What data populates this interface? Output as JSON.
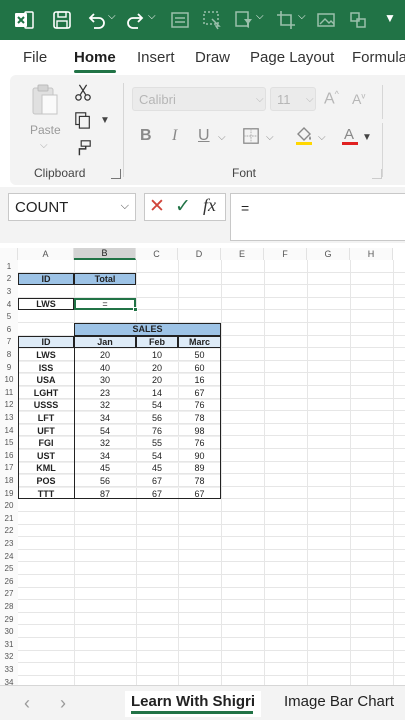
{
  "menu": {
    "tabs": [
      "File",
      "Home",
      "Insert",
      "Draw",
      "Page Layout",
      "Formula"
    ],
    "active": "Home"
  },
  "ribbon": {
    "clipboard": {
      "label": "Clipboard",
      "paste_label": "Paste"
    },
    "font": {
      "label": "Font",
      "font_name": "Calibri",
      "font_size": "11",
      "bold": "B",
      "italic": "I",
      "underline": "U"
    }
  },
  "formula_bar": {
    "name_box": "COUNT",
    "formula": "="
  },
  "grid": {
    "columns": [
      "A",
      "B",
      "C",
      "D",
      "E",
      "F",
      "G",
      "H"
    ],
    "selected_column": "B",
    "rows": [
      "1",
      "2",
      "3",
      "4",
      "5",
      "6",
      "7",
      "8",
      "9",
      "10",
      "11",
      "12",
      "13",
      "14",
      "15",
      "16",
      "17",
      "18",
      "19",
      "20",
      "21",
      "22",
      "23",
      "24",
      "25",
      "26",
      "27",
      "28",
      "29",
      "30",
      "31",
      "32",
      "33",
      "34"
    ],
    "lookup": {
      "id_header": "ID",
      "total_header": "Total",
      "id_value": "LWS",
      "total_value": "="
    },
    "sales_table": {
      "title": "SALES",
      "headers": [
        "ID",
        "Jan",
        "Feb",
        "Marc"
      ],
      "rows": [
        [
          "LWS",
          "20",
          "10",
          "50"
        ],
        [
          "ISS",
          "40",
          "20",
          "60"
        ],
        [
          "USA",
          "30",
          "20",
          "16"
        ],
        [
          "LGHT",
          "23",
          "14",
          "67"
        ],
        [
          "USSS",
          "32",
          "54",
          "76"
        ],
        [
          "LFT",
          "34",
          "56",
          "78"
        ],
        [
          "UFT",
          "54",
          "76",
          "98"
        ],
        [
          "FGI",
          "32",
          "55",
          "76"
        ],
        [
          "UST",
          "34",
          "54",
          "90"
        ],
        [
          "KML",
          "45",
          "45",
          "89"
        ],
        [
          "POS",
          "56",
          "67",
          "78"
        ],
        [
          "TTT",
          "87",
          "67",
          "67"
        ]
      ]
    }
  },
  "sheets": {
    "tabs": [
      "Learn With Shigri",
      "Image Bar Chart"
    ],
    "active": "Learn With Shigri"
  },
  "colors": {
    "brand_green": "#217346",
    "header_blue": "#9dc3e6",
    "subheader_blue": "#deebf7"
  }
}
